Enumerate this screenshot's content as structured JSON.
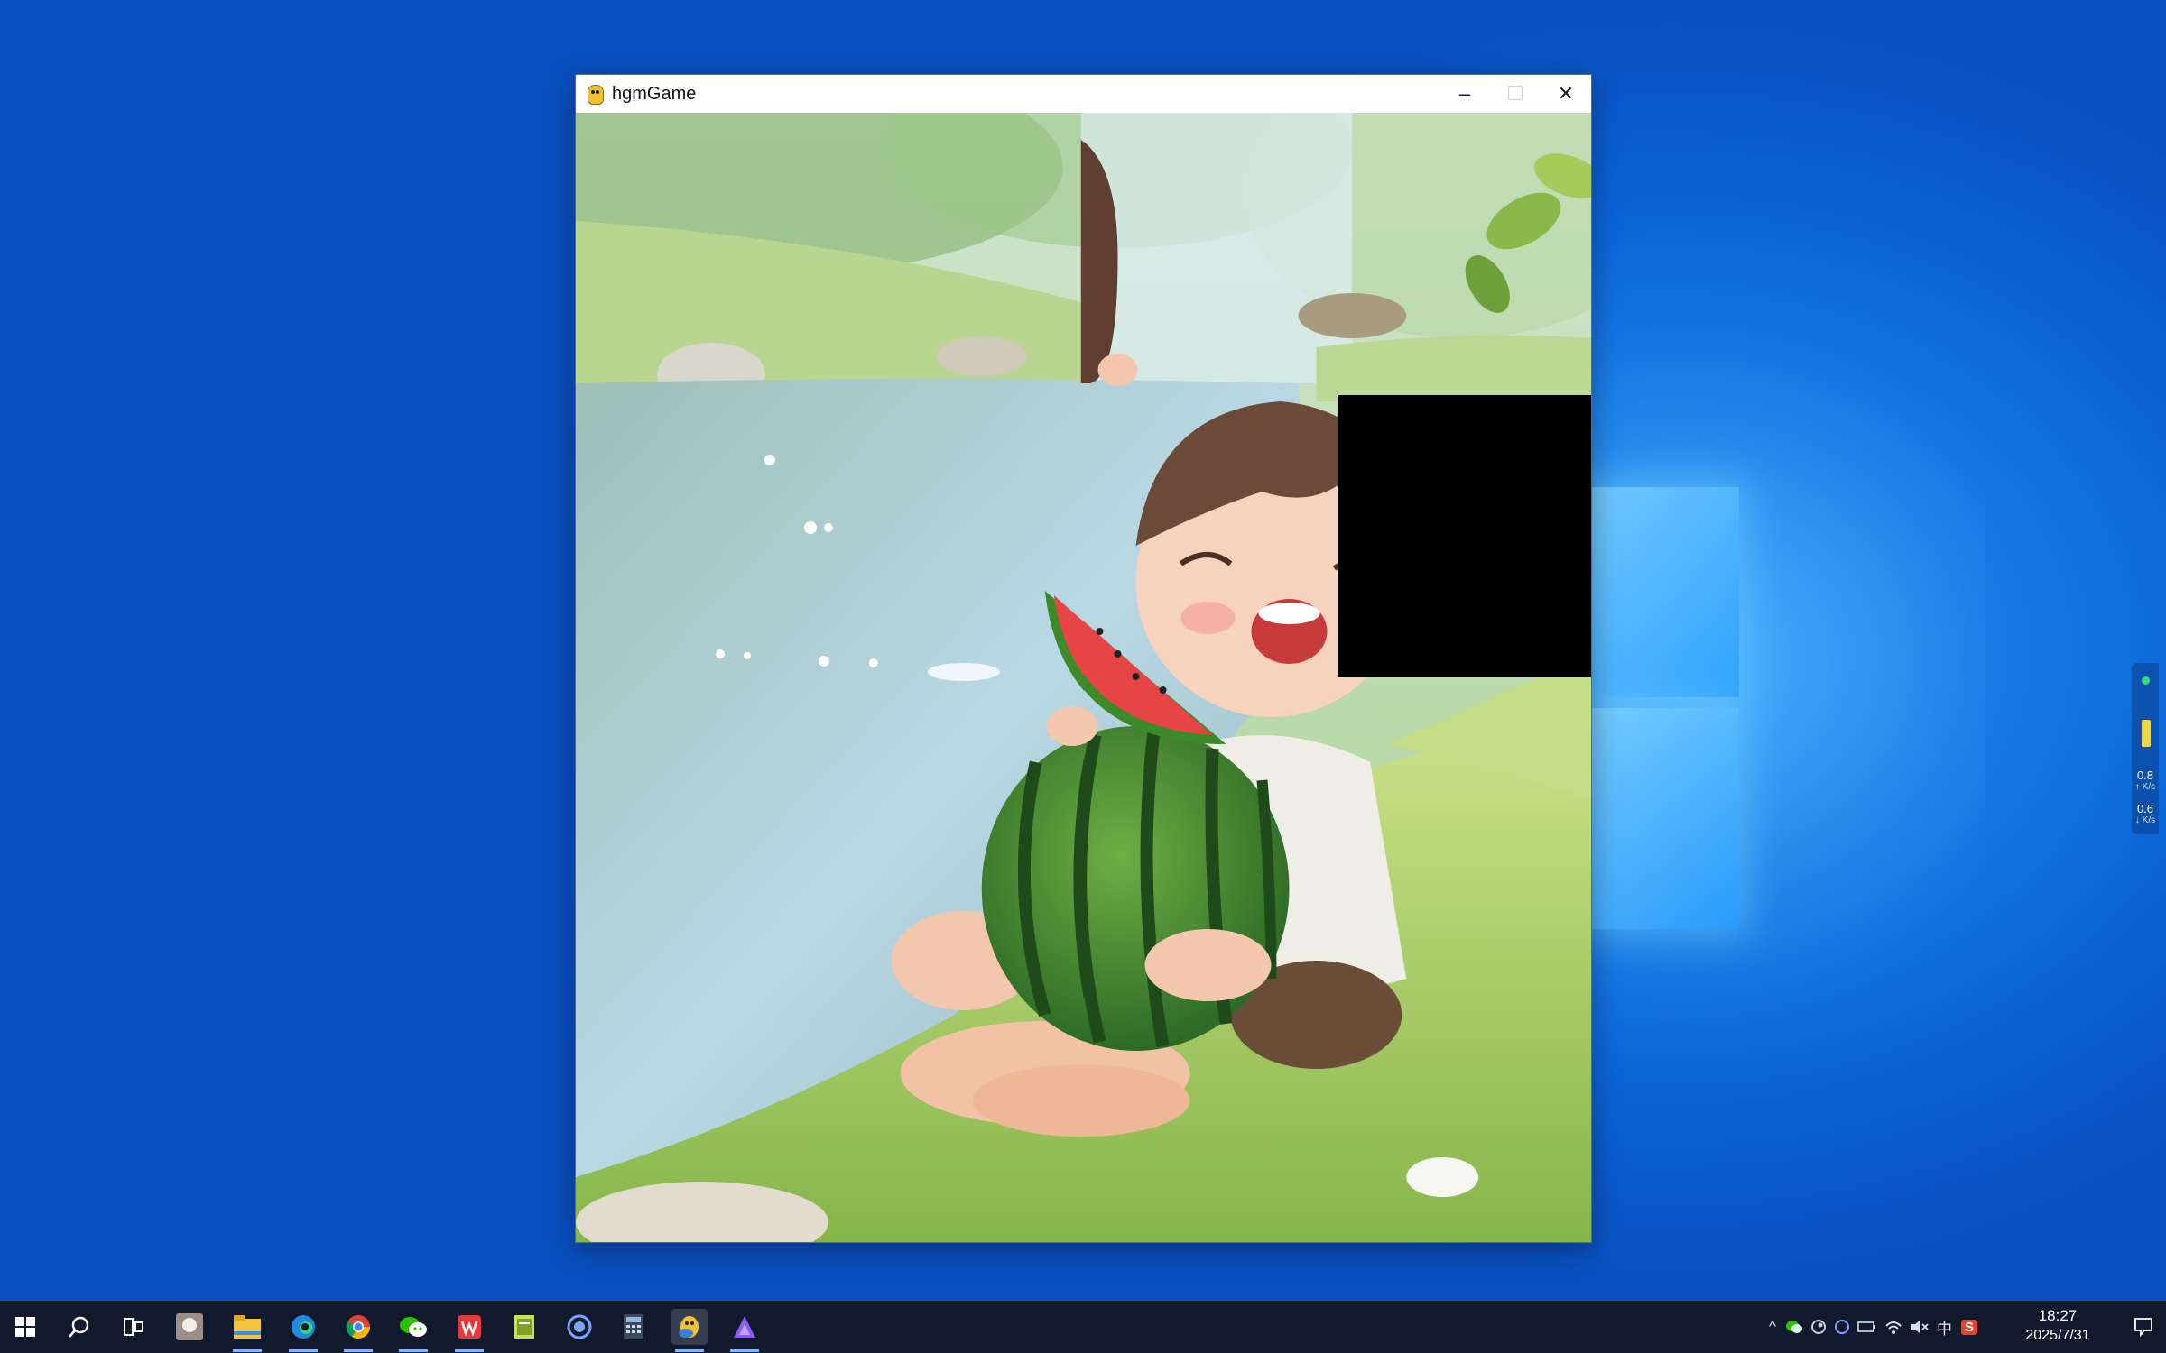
{
  "window": {
    "title": "hgmGame",
    "controls": {
      "minimize": "–",
      "maximize": "☐",
      "close": "✕"
    }
  },
  "puzzle": {
    "columns": 4,
    "rows": 4,
    "empty_tile": "column 4, row 2"
  },
  "widget": {
    "upload_value": "0.8",
    "upload_unit": "↑ K/s",
    "download_value": "0.6",
    "download_unit": "↓ K/s"
  },
  "taskbar": {
    "apps": [
      "start",
      "search",
      "task-view",
      "avatar",
      "file-explorer",
      "edge",
      "chrome",
      "wechat",
      "wps",
      "notepad",
      "cortana",
      "calculator",
      "pygame",
      "assistant"
    ],
    "tray": {
      "lang": "中",
      "ime": "S",
      "time": "18:27",
      "date": "2025/7/31"
    }
  }
}
